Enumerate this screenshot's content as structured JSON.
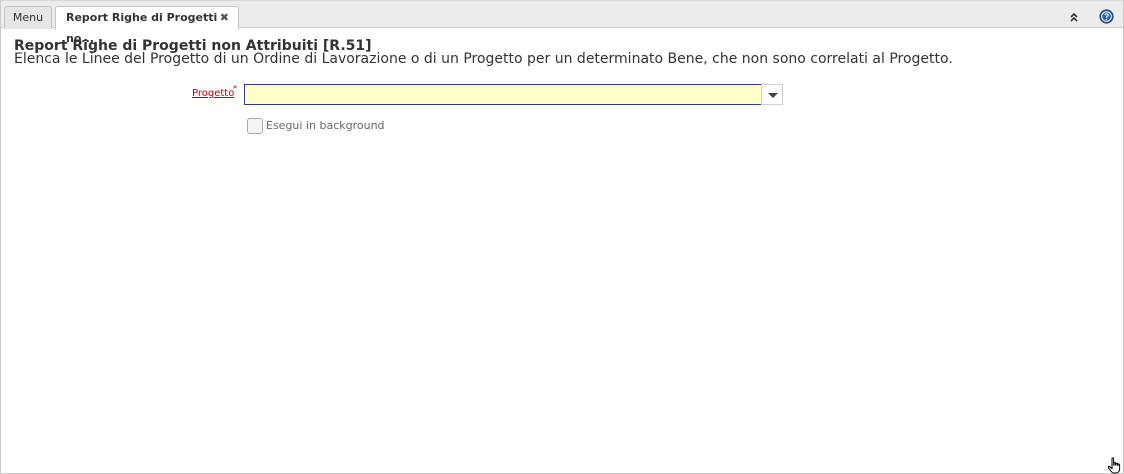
{
  "tabs": {
    "menu_label": "Menu",
    "report_label": "Report Righe di Progetti no...",
    "close_glyph": "✖"
  },
  "header": {
    "title": "Report Righe di Progetti non Attribuiti [R.51]",
    "description": "Elenca le Linee del Progetto di un Ordine di Lavorazione o di un Progetto per un determinato Bene, che non sono correlati al Progetto."
  },
  "form": {
    "project_field": {
      "label": "Progetto",
      "required_mark": "*",
      "value": "",
      "placeholder": ""
    },
    "background_checkbox": {
      "label": "Esegui in background",
      "checked": false
    }
  },
  "icons": {
    "collapse": "double-chevron-up-icon",
    "help": "help-icon",
    "dropdown": "chevron-down-icon",
    "cursor": "hand-pointer-icon"
  },
  "colors": {
    "required_label": "#c40000",
    "input_focus_border": "#2b3a9c",
    "input_background": "#ffffc8",
    "help_icon": "#2a5ca8"
  }
}
